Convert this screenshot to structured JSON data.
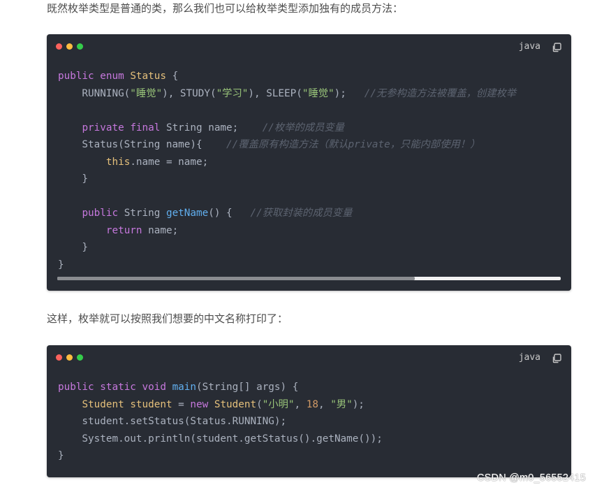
{
  "paragraph_1": "既然枚举类型是普通的类，那么我们也可以给枚举类型添加独有的成员方法：",
  "paragraph_2": "这样，枚举就可以按照我们想要的中文名称打印了：",
  "code_block_1": {
    "language": "java",
    "scroll_thumb_fraction": 0.71,
    "lines": [
      [
        "public enum Status {"
      ],
      [
        "    RUNNING(\"睡觉\"), STUDY(\"学习\"), SLEEP(\"睡觉\");   //无参构造方法被覆盖，创建枚举"
      ],
      [
        ""
      ],
      [
        "    private final String name;    //枚举的成员变量"
      ],
      [
        "    Status(String name){    //覆盖原有构造方法（默认private，只能内部使用！）"
      ],
      [
        "        this.name = name;"
      ],
      [
        "    }"
      ],
      [
        ""
      ],
      [
        "    public String getName() {   //获取封装的成员变量"
      ],
      [
        "        return name;"
      ],
      [
        "    }"
      ],
      [
        "}"
      ]
    ]
  },
  "code_block_2": {
    "language": "java",
    "lines": [
      [
        "public static void main(String[] args) {"
      ],
      [
        "    Student student = new Student(\"小明\", 18, \"男\");"
      ],
      [
        "    student.setStatus(Status.RUNNING);"
      ],
      [
        "    System.out.println(student.getStatus().getName());"
      ],
      [
        "}"
      ]
    ]
  },
  "watermark": "CSDN @m0_56552415",
  "icons": {
    "window_dots": [
      "red-dot",
      "yellow-dot",
      "green-dot"
    ],
    "copy": "copy-icon"
  },
  "colors": {
    "code_bg": "#282c34",
    "keyword": "#c678dd",
    "type": "#e5c07b",
    "string": "#98c379",
    "function": "#61afef",
    "number": "#d19a66",
    "comment": "#5c6370",
    "plain": "#abb2bf"
  }
}
